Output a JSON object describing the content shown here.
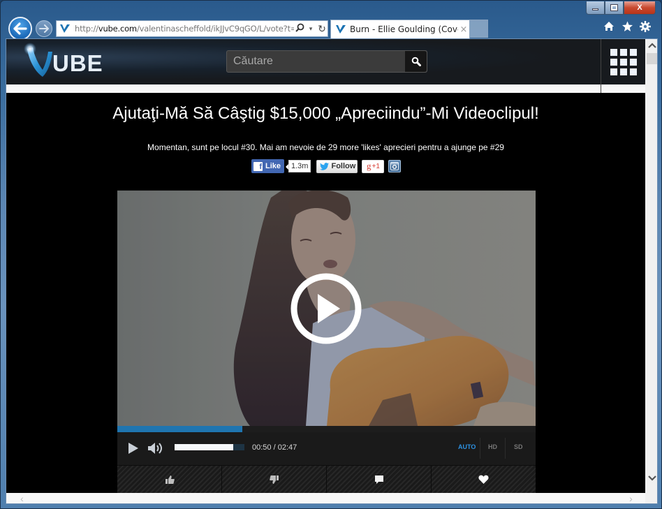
{
  "browser": {
    "url_prefix": "http://",
    "url_domain": "vube.com",
    "url_path": "/valentinascheffold/ikJJvC9qGO/L/vote?t=",
    "tab_title": "Burn - Ellie Goulding (Cove...",
    "tab_close": "×",
    "icons": {
      "back": "arrow-left",
      "forward": "arrow-right",
      "search": "magnifier",
      "dropdown": "▾",
      "refresh": "↻",
      "home": "home",
      "favorites": "star",
      "settings": "gear"
    },
    "window_controls": {
      "minimize": "minimize",
      "maximize": "maximize",
      "close": "X"
    }
  },
  "site": {
    "logo_text": "UBE",
    "search_placeholder": "Căutare",
    "search_value": "",
    "brand_color": "#1f75b0"
  },
  "contest": {
    "headline": "Ajutaţi-Mă Să Câştig $15,000 „Apreciindu”-Mi Videoclipul!",
    "status": "Momentan, sunt pe locul #30. Mai am nevoie de 29 more 'likes' aprecieri pentru a ajunge pe #29"
  },
  "social": {
    "facebook_label": "Like",
    "facebook_count": "1.3m",
    "twitter_label": "Follow",
    "gplus_label": "g",
    "gplus_suffix": "+1",
    "instagram": "instagram"
  },
  "player": {
    "current_time": "00:50",
    "separator": " / ",
    "duration": "02:47",
    "progress_percent": 29.9,
    "volume_percent": 84,
    "quality_options": [
      "AUTO",
      "HD",
      "SD"
    ],
    "quality_selected": "AUTO",
    "accent_color": "#2d90e0",
    "actions": [
      "thumbs-up",
      "thumbs-down",
      "comment",
      "heart"
    ]
  },
  "scroll": {
    "up": "⌃",
    "down": "⌄",
    "left": "‹",
    "right": "›"
  }
}
